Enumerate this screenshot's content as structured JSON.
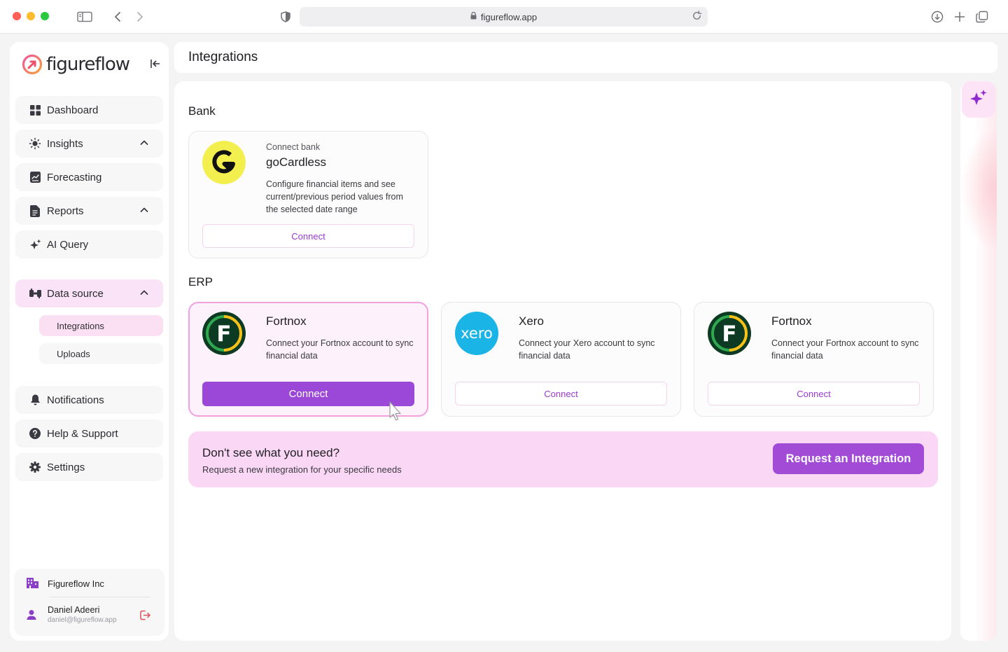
{
  "browser": {
    "url": "figureflow.app"
  },
  "brand": {
    "name": "figureflow",
    "accent": "#9b48d8",
    "pink": "#fbd7f6"
  },
  "sidebar": {
    "items": [
      {
        "label": "Dashboard",
        "icon": "grid-icon"
      },
      {
        "label": "Insights",
        "icon": "lightbulb-icon"
      },
      {
        "label": "Forecasting",
        "icon": "chart-doc-icon"
      },
      {
        "label": "Reports",
        "icon": "document-icon"
      },
      {
        "label": "AI Query",
        "icon": "sparkles-icon"
      },
      {
        "label": "Data source",
        "icon": "database-icon"
      }
    ],
    "sub_items": [
      {
        "label": "Integrations"
      },
      {
        "label": "Uploads"
      }
    ],
    "bottom_items": [
      {
        "label": "Notifications",
        "icon": "bell-icon"
      },
      {
        "label": "Help & Support",
        "icon": "help-icon"
      },
      {
        "label": "Settings",
        "icon": "gear-icon"
      }
    ],
    "account": {
      "org": "Figureflow Inc",
      "user_name": "Daniel Adeeri",
      "user_email": "daniel@figureflow.app"
    }
  },
  "header": {
    "title": "Integrations"
  },
  "sections": {
    "bank": {
      "title": "Bank",
      "card": {
        "subtitle": "Connect bank",
        "title": "goCardless",
        "description": "Configure financial items and see current/previous period values from the selected date range",
        "button": "Connect"
      }
    },
    "erp": {
      "title": "ERP",
      "cards": [
        {
          "title": "Fortnox",
          "description": "Connect your Fortnox account to sync financial data",
          "button": "Connect"
        },
        {
          "title": "Xero",
          "description": "Connect your Xero account to sync financial data",
          "button": "Connect",
          "logo_text": "xero"
        },
        {
          "title": "Fortnox",
          "description": "Connect your Fortnox account to sync financial data",
          "button": "Connect"
        }
      ]
    }
  },
  "cta": {
    "title": "Don't see what you need?",
    "subtitle": "Request a new integration for your specific needs",
    "button": "Request an Integration"
  }
}
